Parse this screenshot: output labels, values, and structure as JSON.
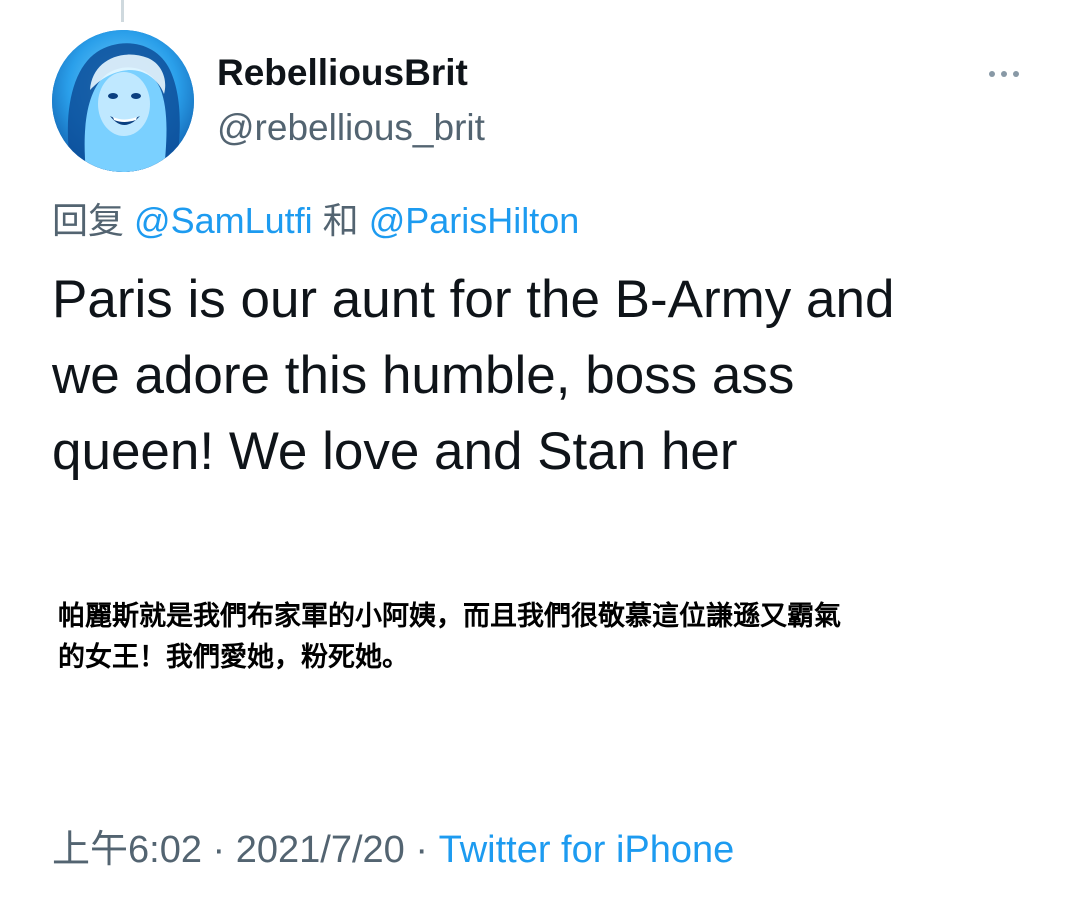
{
  "user": {
    "display_name": "RebelliousBrit",
    "handle": "@rebellious_brit"
  },
  "reply": {
    "prefix": "回复",
    "mention_1": "@SamLutfi",
    "joiner": "和",
    "mention_2": "@ParisHilton"
  },
  "tweet": {
    "lines": [
      "Paris is our aunt for the B-Army and",
      "we adore this humble, boss ass",
      "queen! We love and Stan her"
    ]
  },
  "translation": {
    "lines": [
      "帕麗斯就是我們布家軍的小阿姨，而且我們很敬慕這位謙遜又霸氣",
      "的女王！我們愛她，粉死她。"
    ]
  },
  "meta": {
    "time": "上午6:02",
    "separator": "·",
    "date": "2021/7/20",
    "source": "Twitter for iPhone"
  },
  "icons": {
    "more": "more-horizontal-icon",
    "avatar": "profile-photo"
  },
  "colors": {
    "link": "#1d9bf0",
    "secondary_text": "#536471",
    "primary_text": "#0f1419"
  }
}
